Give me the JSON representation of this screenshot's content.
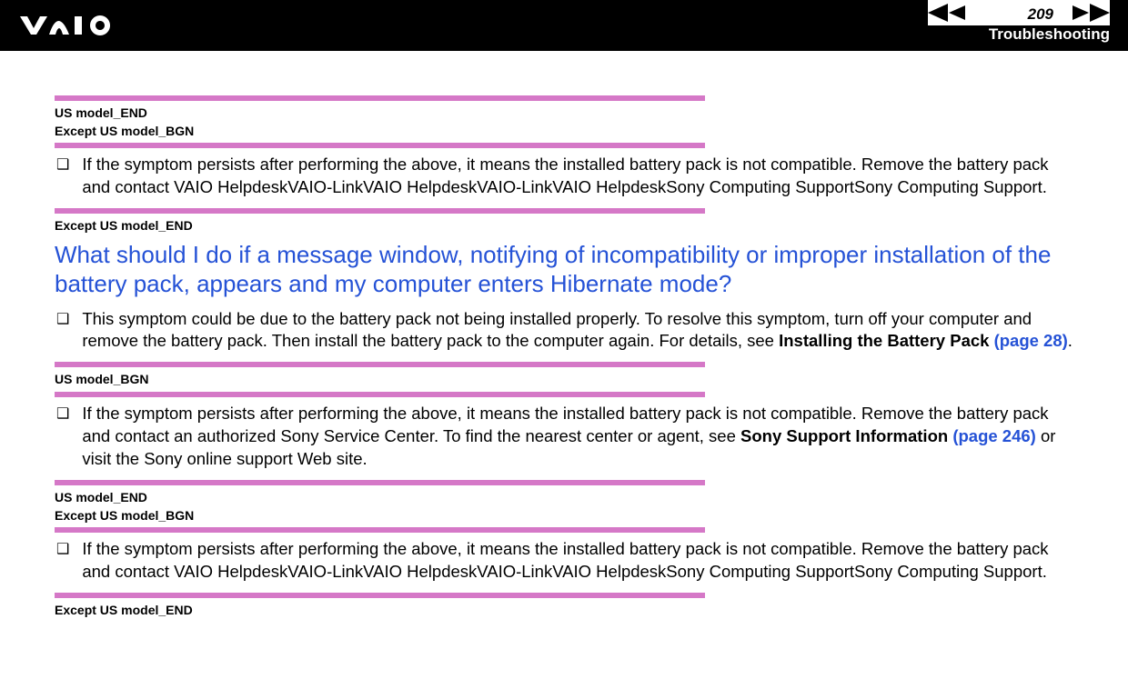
{
  "header": {
    "page_number": "209",
    "section_title": "Troubleshooting"
  },
  "tags": {
    "us_end": "US model_END",
    "except_us_bgn": "Except US model_BGN",
    "except_us_end": "Except US model_END",
    "us_bgn": "US model_BGN"
  },
  "bullets": {
    "b1": "If the symptom persists after performing the above, it means the installed battery pack is not compatible. Remove the battery pack and contact VAIO HelpdeskVAIO-LinkVAIO HelpdeskVAIO-LinkVAIO HelpdeskSony Computing SupportSony Computing Support.",
    "b2_pre": "This symptom could be due to the battery pack not being installed properly. To resolve this symptom, turn off your computer and remove the battery pack. Then install the battery pack to the computer again. For details, see ",
    "b2_bold": "Installing the Battery Pack ",
    "b2_link": "(page 28)",
    "b2_post": ".",
    "b3_pre": "If the symptom persists after performing the above, it means the installed battery pack is not compatible. Remove the battery pack and contact an authorized Sony Service Center. To find the nearest center or agent, see ",
    "b3_bold": "Sony Support Information ",
    "b3_link": "(page 246)",
    "b3_post": " or visit the Sony online support Web site.",
    "b4": "If the symptom persists after performing the above, it means the installed battery pack is not compatible. Remove the battery pack and contact VAIO HelpdeskVAIO-LinkVAIO HelpdeskVAIO-LinkVAIO HelpdeskSony Computing SupportSony Computing Support."
  },
  "heading": "What should I do if a message window, notifying of incompatibility or improper installation of the battery pack, appears and my computer enters Hibernate mode?"
}
